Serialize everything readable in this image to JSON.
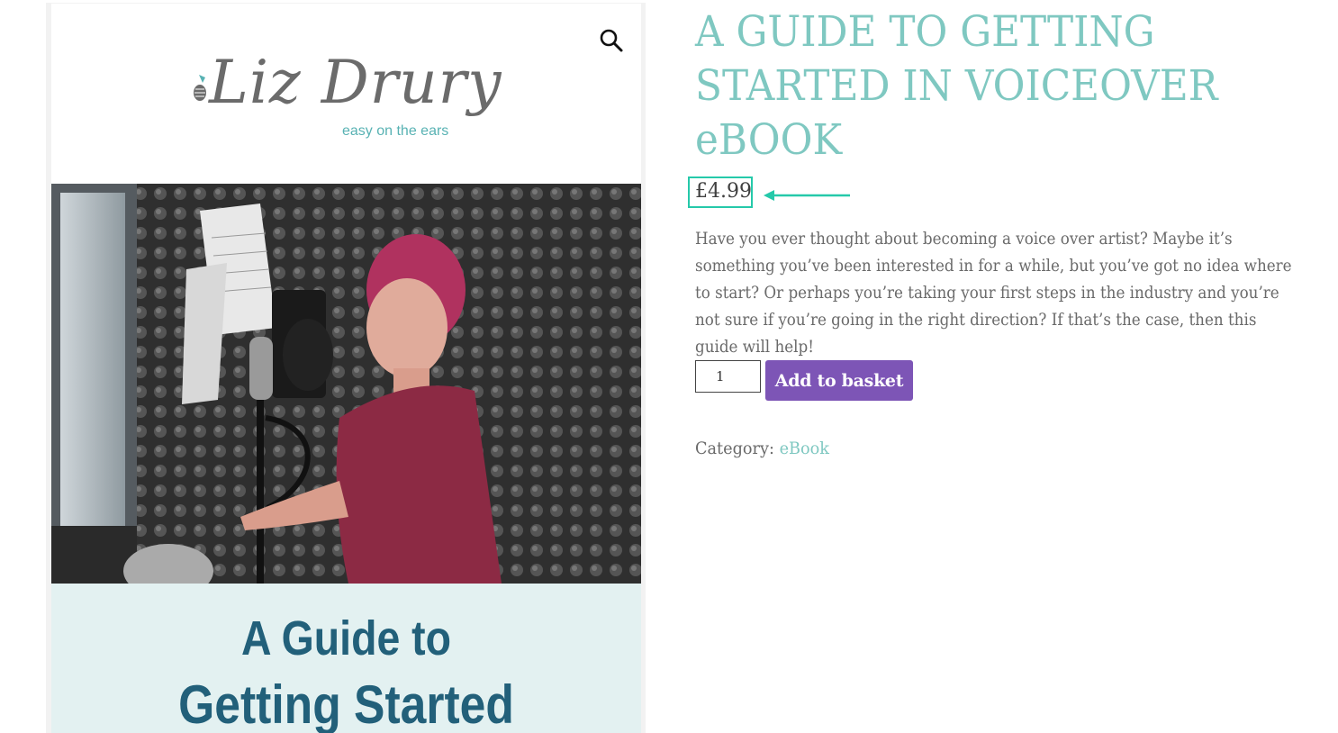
{
  "gallery": {
    "zoom_icon": "magnifier-icon",
    "cover": {
      "logo_name": "Liz Drury",
      "logo_tagline": "easy on the ears",
      "title_line1": "A Guide to",
      "title_line2": "Getting Started"
    }
  },
  "product": {
    "title": "A GUIDE TO GETTING STARTED IN VOICEOVER eBOOK",
    "price": "£4.99",
    "description": "Have you ever thought about becoming a voice over artist? Maybe it’s something you’ve been interested in for a while, but you’ve got no idea where to start? Or perhaps you’re taking your first steps in the industry and you’re not sure if you’re going in the right direction? If that’s the case, then this guide will help!",
    "quantity": "1",
    "add_to_basket_label": "Add to basket",
    "category_label": "Category:",
    "category_value": "eBook"
  },
  "colors": {
    "accent_teal": "#7fc8c1",
    "highlight": "#25c9aa",
    "button": "#7d55b6",
    "cover_title": "#22607a"
  }
}
